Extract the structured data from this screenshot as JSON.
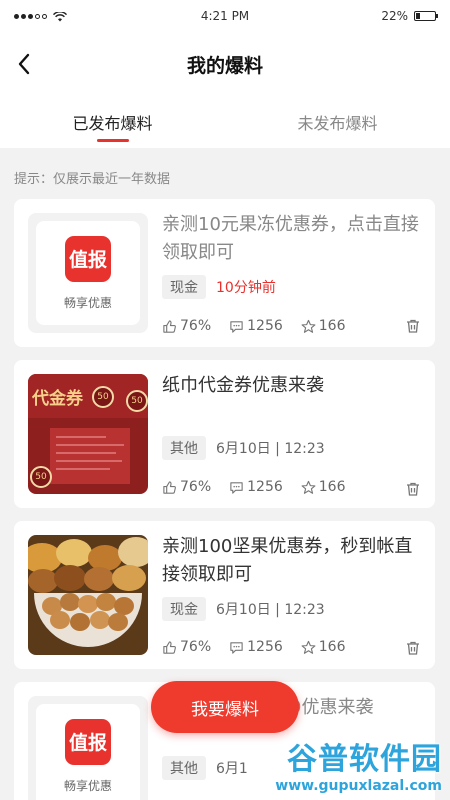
{
  "status_bar": {
    "time": "4:21 PM",
    "battery": "22%",
    "battery_level": 0.22
  },
  "nav": {
    "title": "我的爆料"
  },
  "tabs": [
    {
      "label": "已发布爆料",
      "active": true
    },
    {
      "label": "未发布爆料",
      "active": false
    }
  ],
  "hint": "提示：仅展示最近一年数据",
  "logo": {
    "badge": "值报",
    "caption": "畅享优惠"
  },
  "cards": [
    {
      "title": "亲测10元果冻优惠券，点击直接领取即可",
      "tag": "现金",
      "time": "10分钟前",
      "likes": "76%",
      "comments": "1256",
      "stars": "166"
    },
    {
      "title": "纸巾代金券优惠来袭",
      "tag": "其他",
      "time": "6月10日 | 12:23",
      "likes": "76%",
      "comments": "1256",
      "stars": "166",
      "coupon_text": "代金券",
      "coupon_value": "50"
    },
    {
      "title": "亲测100坚果优惠券，秒到帐直接领取即可",
      "tag": "现金",
      "time": "6月10日 | 12:23",
      "likes": "76%",
      "comments": "1256",
      "stars": "166"
    },
    {
      "title_visible": "9优惠来袭",
      "tag": "其他",
      "time_visible": "6月1"
    }
  ],
  "fab": {
    "label": "我要爆料"
  },
  "watermark": {
    "cn": "谷普软件园",
    "url": "www.gupuxlazal.com"
  },
  "colors": {
    "accent": "#e8322e",
    "watermark": "#2da4dc"
  }
}
